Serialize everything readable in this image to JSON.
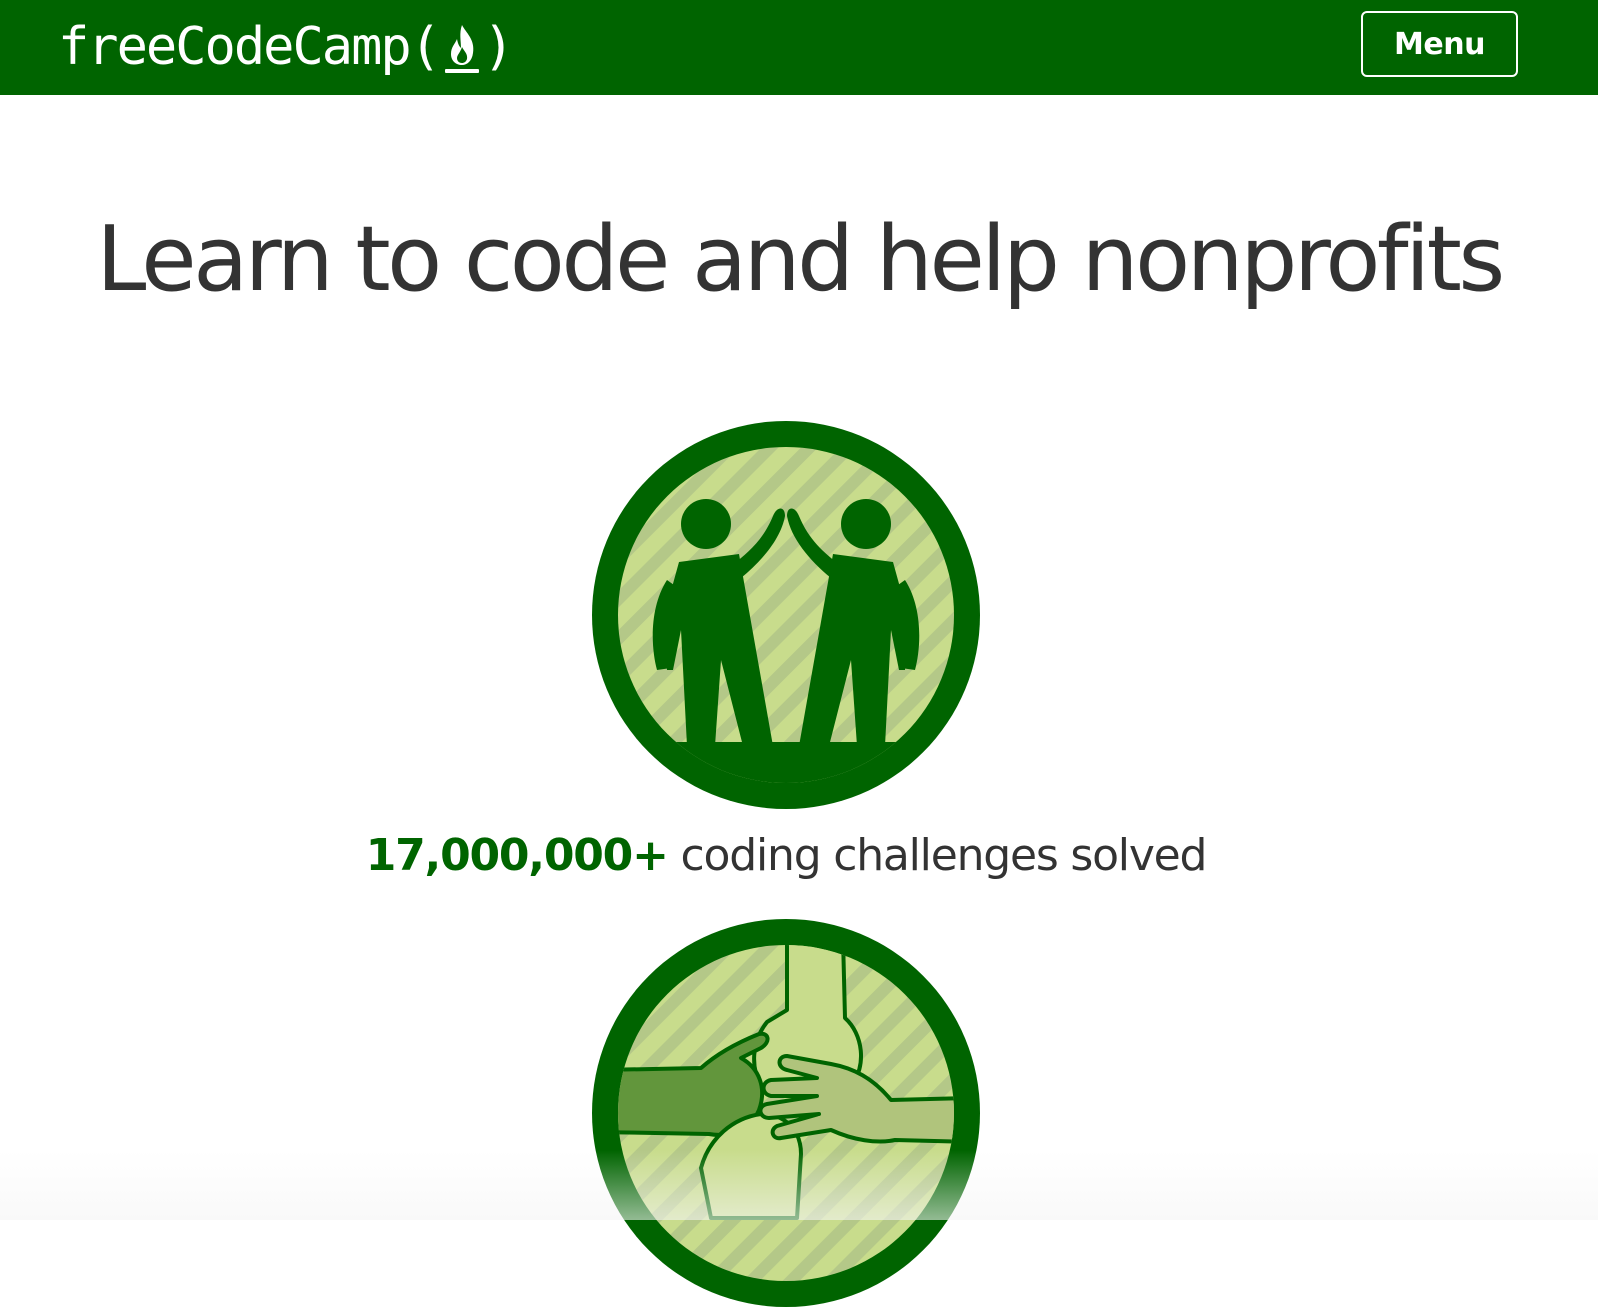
{
  "navbar": {
    "brand_text": "freeCodeCamp",
    "brand_paren_open": "(",
    "brand_paren_close": ")",
    "brand_icon": "flame-icon",
    "menu_label": "Menu"
  },
  "hero": {
    "title": "Learn to code and help nonprofits"
  },
  "stats": {
    "challenges_count": "17,000,000+",
    "challenges_label": " coding challenges solved"
  },
  "badges": [
    {
      "icon": "high-five-icon"
    },
    {
      "icon": "stacked-hands-icon"
    }
  ],
  "colors": {
    "brand_green": "#006400",
    "badge_light_green": "#c8dc8c",
    "badge_stripe_green": "#b4c888",
    "hand_mid_green": "#62963c",
    "hand_light_green": "#b0c47c",
    "text_dark": "#333333",
    "background": "#ffffff"
  }
}
